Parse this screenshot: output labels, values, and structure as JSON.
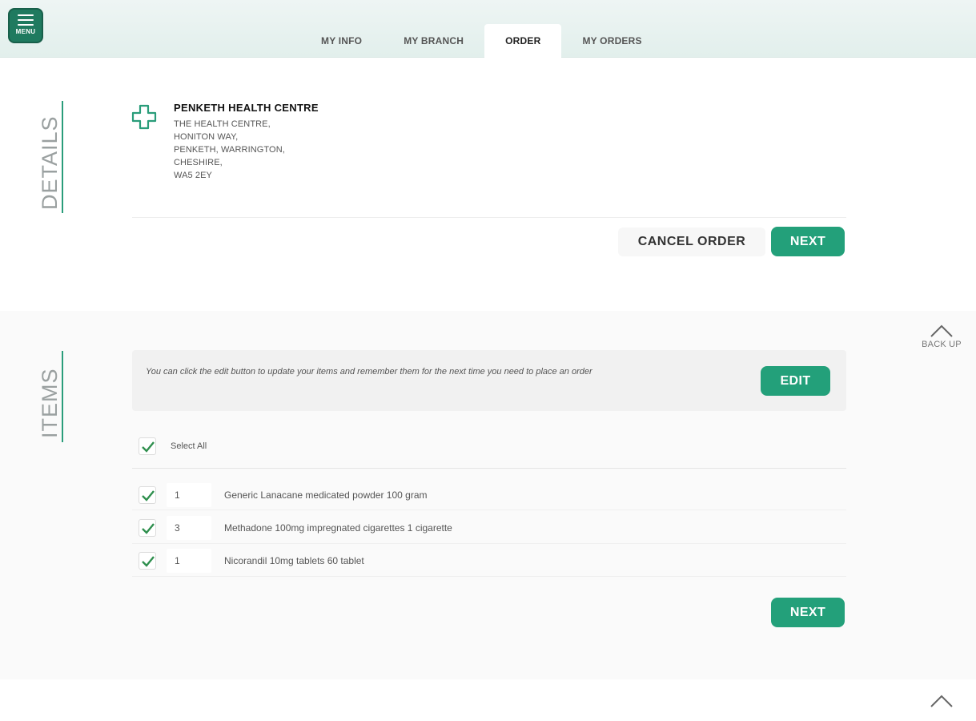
{
  "header": {
    "menu_label": "MENU",
    "tabs": [
      {
        "label": "MY INFO"
      },
      {
        "label": "MY BRANCH"
      },
      {
        "label": "ORDER"
      },
      {
        "label": "MY ORDERS"
      }
    ],
    "active_tab": "ORDER"
  },
  "details": {
    "section_label": "DETAILS",
    "branch_name": "PENKETH HEALTH CENTRE",
    "address": [
      "THE HEALTH CENTRE,",
      "HONITON WAY,",
      "PENKETH, WARRINGTON,",
      "CHESHIRE,",
      "WA5 2EY"
    ],
    "cancel_label": "CANCEL ORDER",
    "next_label": "NEXT"
  },
  "items": {
    "section_label": "ITEMS",
    "info_text": "You can click the edit button to update your items and remember them for the next time you need to place an order",
    "edit_label": "EDIT",
    "select_all_label": "Select All",
    "list": [
      {
        "qty": "1",
        "name": "Generic Lanacane medicated powder 100 gram",
        "checked": true
      },
      {
        "qty": "3",
        "name": "Methadone 100mg impregnated cigarettes 1 cigarette",
        "checked": true
      },
      {
        "qty": "1",
        "name": "Nicorandil 10mg tablets 60 tablet",
        "checked": true
      }
    ],
    "next_label": "NEXT"
  },
  "backup": {
    "label": "BACK UP"
  },
  "colors": {
    "accent": "#23a07a",
    "rule": "#2a9d7a",
    "menu": "#1f7a5f",
    "check": "#2f8f4e"
  }
}
